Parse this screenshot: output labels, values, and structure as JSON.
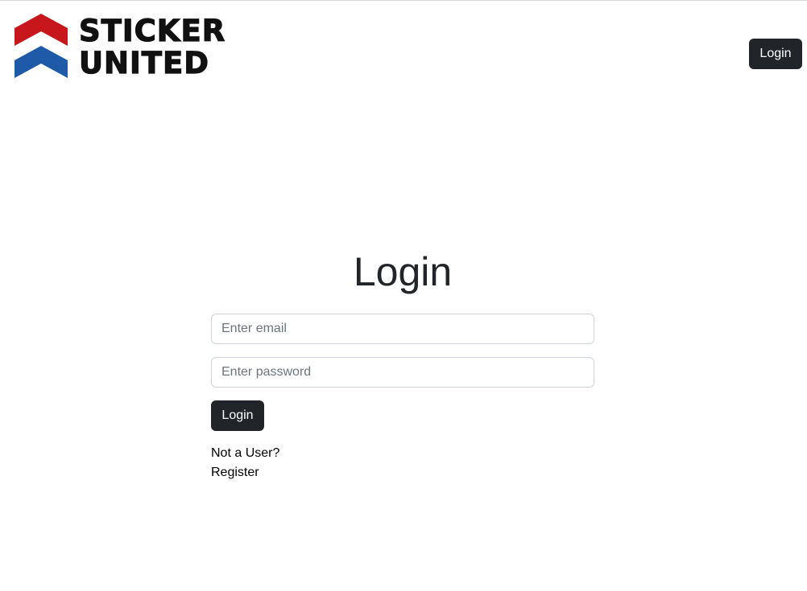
{
  "brand": {
    "logo_text_line1": "STICKER",
    "logo_text_line2": "UNITED",
    "colors": {
      "red": "#c8161d",
      "blue": "#1e5aa8"
    }
  },
  "navbar": {
    "login_label": "Login"
  },
  "form": {
    "title": "Login",
    "email_placeholder": "Enter email",
    "email_value": "",
    "password_placeholder": "Enter password",
    "password_value": "",
    "submit_label": "Login",
    "not_user_text": "Not a User?",
    "register_label": "Register"
  },
  "theme": {
    "button_bg": "#212529",
    "button_text": "#ffffff",
    "input_border": "#ced4da"
  }
}
